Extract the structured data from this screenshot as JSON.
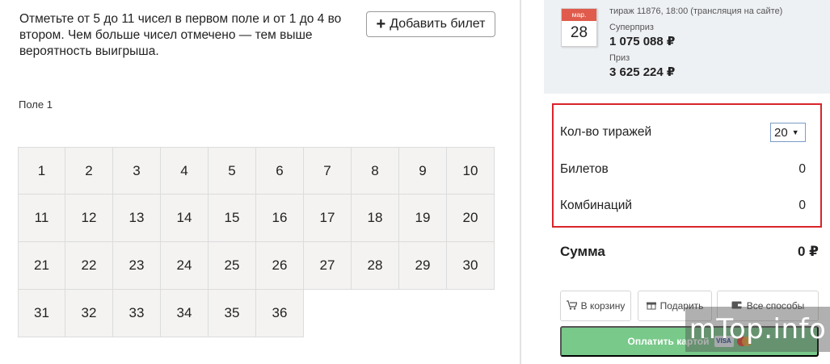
{
  "instructions": "Отметьте от 5 до 11 чисел в первом поле и от 1 до 4 во втором. Чем больше чисел отмечено — тем выше вероятность выигрыша.",
  "add_ticket": {
    "icon": "plus-icon",
    "label": "Добавить билет"
  },
  "field1": {
    "label": "Поле 1",
    "numbers": [
      [
        "1",
        "2",
        "3",
        "4",
        "5",
        "6",
        "7",
        "8",
        "9",
        "10"
      ],
      [
        "11",
        "12",
        "13",
        "14",
        "15",
        "16",
        "17",
        "18",
        "19",
        "20"
      ],
      [
        "21",
        "22",
        "23",
        "24",
        "25",
        "26",
        "27",
        "28",
        "29",
        "30"
      ],
      [
        "31",
        "32",
        "33",
        "34",
        "35",
        "36"
      ]
    ]
  },
  "draw": {
    "month": "мар.",
    "day": "28",
    "info": "тираж 11876, 18:00 (трансляция на сайте)",
    "jackpot_label": "Суперприз",
    "jackpot_value": "1 075 088 ₽",
    "prize_label": "Приз",
    "prize_value": "3 625 224 ₽"
  },
  "options": {
    "draws_label": "Кол-во тиражей",
    "draws_value": "20",
    "tickets_label": "Билетов",
    "tickets_value": "0",
    "combos_label": "Комбинаций",
    "combos_value": "0"
  },
  "sum": {
    "label": "Сумма",
    "value": "0 ₽"
  },
  "buttons": {
    "cart": "В корзину",
    "gift": "Подарить",
    "all": "Все способы",
    "pay": "Оплатить картой"
  },
  "pay_logos": {
    "visa": "VISA"
  },
  "watermark": "mTop.info",
  "colors": {
    "highlight": "#d9242b",
    "pay": "#79c98a",
    "calendar": "#e05b4b",
    "grid_cell": "#f4f3f1"
  }
}
